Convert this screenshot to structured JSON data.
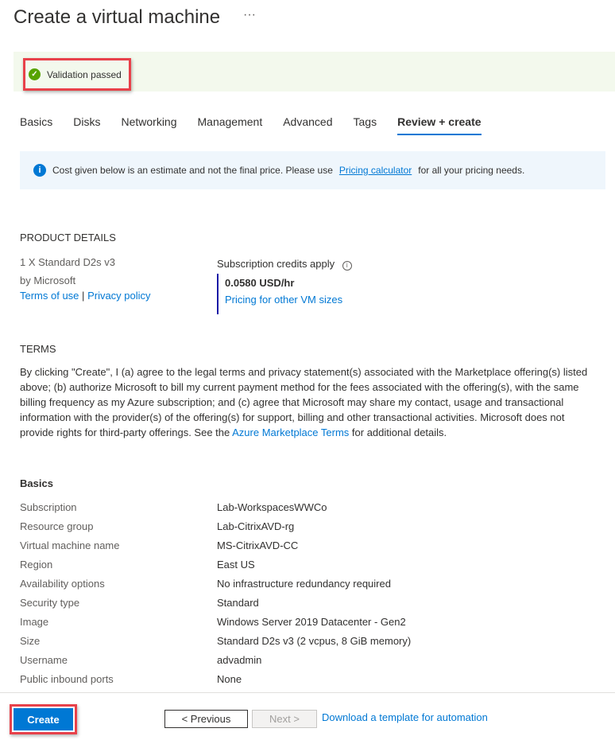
{
  "header": {
    "title": "Create a virtual machine",
    "more": "···"
  },
  "validation": {
    "text": "Validation passed"
  },
  "tabs": [
    {
      "label": "Basics"
    },
    {
      "label": "Disks"
    },
    {
      "label": "Networking"
    },
    {
      "label": "Management"
    },
    {
      "label": "Advanced"
    },
    {
      "label": "Tags"
    },
    {
      "label": "Review + create"
    }
  ],
  "info": {
    "text": "Cost given below is an estimate and not the final price. Please use",
    "link": "Pricing calculator",
    "suffix": "for all your pricing needs."
  },
  "product": {
    "heading": "PRODUCT DETAILS",
    "name": "1 X Standard D2s v3",
    "publisher": "by Microsoft",
    "terms_link": "Terms of use",
    "sep": "|",
    "privacy_link": "Privacy policy",
    "credits": "Subscription credits apply",
    "price": "0.0580 USD/hr",
    "pricing_link": "Pricing for other VM sizes"
  },
  "terms": {
    "heading": "TERMS",
    "text": "By clicking \"Create\", I (a) agree to the legal terms and privacy statement(s) associated with the Marketplace offering(s) listed above; (b) authorize Microsoft to bill my current payment method for the fees associated with the offering(s), with the same billing frequency as my Azure subscription; and (c) agree that Microsoft may share my contact, usage and transactional information with the provider(s) of the offering(s) for support, billing and other transactional activities. Microsoft does not provide rights for third-party offerings. See the",
    "link": "Azure Marketplace Terms",
    "suffix": "for additional details."
  },
  "basics": {
    "heading": "Basics",
    "rows": [
      {
        "k": "Subscription",
        "v": "Lab-WorkspacesWWCo"
      },
      {
        "k": "Resource group",
        "v": "Lab-CitrixAVD-rg"
      },
      {
        "k": "Virtual machine name",
        "v": "MS-CitrixAVD-CC"
      },
      {
        "k": "Region",
        "v": "East US"
      },
      {
        "k": "Availability options",
        "v": "No infrastructure redundancy required"
      },
      {
        "k": "Security type",
        "v": "Standard"
      },
      {
        "k": "Image",
        "v": "Windows Server 2019 Datacenter - Gen2"
      },
      {
        "k": "Size",
        "v": "Standard D2s v3 (2 vcpus, 8 GiB memory)"
      },
      {
        "k": "Username",
        "v": "advadmin"
      },
      {
        "k": "Public inbound ports",
        "v": "None"
      }
    ]
  },
  "footer": {
    "create": "Create",
    "previous": "< Previous",
    "next": "Next >",
    "download": "Download a template for automation"
  }
}
